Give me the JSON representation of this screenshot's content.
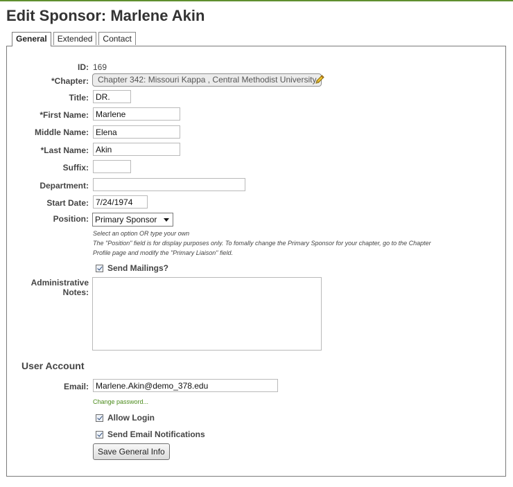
{
  "page": {
    "title": "Edit Sponsor: Marlene Akin"
  },
  "tabs": [
    {
      "label": "General",
      "active": true
    },
    {
      "label": "Extended",
      "active": false
    },
    {
      "label": "Contact",
      "active": false
    }
  ],
  "form": {
    "id_label": "ID:",
    "id_value": "169",
    "chapter_label": "*Chapter:",
    "chapter_value": "Chapter 342: Missouri Kappa , Central Methodist University",
    "title_label": "Title:",
    "title_value": "DR.",
    "first_name_label": "*First Name:",
    "first_name_value": "Marlene",
    "middle_name_label": "Middle Name:",
    "middle_name_value": "Elena",
    "last_name_label": "*Last Name:",
    "last_name_value": "Akin",
    "suffix_label": "Suffix:",
    "suffix_value": "",
    "department_label": "Department:",
    "department_value": "",
    "start_date_label": "Start Date:",
    "start_date_value": "7/24/1974",
    "position_label": "Position:",
    "position_value": "Primary Sponsor",
    "position_hint_1": "Select an option OR type your own",
    "position_hint_2": "The \"Position\" field is for display purposes only. To fomally change the Primary Sponsor for your chapter, go to the Chapter",
    "position_hint_3": "Profile page and modify the \"Primary Liaison\" field.",
    "send_mailings_label": "Send Mailings?",
    "send_mailings_checked": true,
    "notes_label_1": "Administrative",
    "notes_label_2": "Notes:",
    "notes_value": ""
  },
  "user_account": {
    "heading": "User Account",
    "email_label": "Email:",
    "email_value": "Marlene.Akin@demo_378.edu",
    "change_password": "Change password...",
    "allow_login_label": "Allow Login",
    "allow_login_checked": true,
    "send_notifications_label": "Send Email Notifications",
    "send_notifications_checked": true,
    "save_label": "Save General Info"
  },
  "icons": {
    "edit": "pencil-icon",
    "dropdown": "chevron-down-icon"
  },
  "colors": {
    "accent": "#5f8f2f",
    "link": "#4a8a1a"
  }
}
